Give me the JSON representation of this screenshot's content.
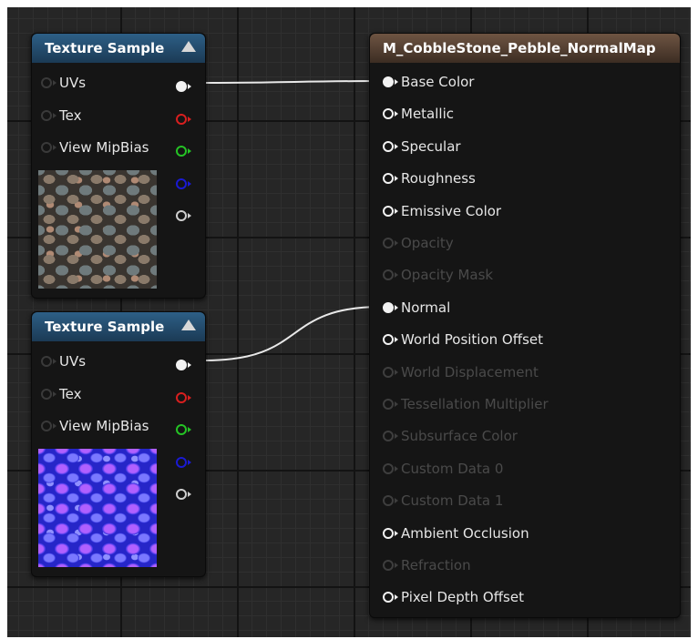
{
  "texture_nodes": [
    {
      "title": "Texture Sample",
      "inputs": [
        "UVs",
        "Tex",
        "View MipBias"
      ],
      "preview": "cobblestone-color-preview"
    },
    {
      "title": "Texture Sample",
      "inputs": [
        "UVs",
        "Tex",
        "View MipBias"
      ],
      "preview": "cobblestone-normal-preview"
    }
  ],
  "output_pin_colors": [
    "#f2f2f2",
    "#d81f1f",
    "#25c325",
    "#1a1ad2",
    "#cfcfcf"
  ],
  "material_node": {
    "title": "M_CobbleStone_Pebble_NormalMap",
    "pins": [
      {
        "label": "Base Color",
        "state": "connected"
      },
      {
        "label": "Metallic",
        "state": "active"
      },
      {
        "label": "Specular",
        "state": "active"
      },
      {
        "label": "Roughness",
        "state": "active"
      },
      {
        "label": "Emissive Color",
        "state": "active"
      },
      {
        "label": "Opacity",
        "state": "disabled"
      },
      {
        "label": "Opacity Mask",
        "state": "disabled"
      },
      {
        "label": "Normal",
        "state": "connected"
      },
      {
        "label": "World Position Offset",
        "state": "active"
      },
      {
        "label": "World Displacement",
        "state": "disabled"
      },
      {
        "label": "Tessellation Multiplier",
        "state": "disabled"
      },
      {
        "label": "Subsurface Color",
        "state": "disabled"
      },
      {
        "label": "Custom Data 0",
        "state": "disabled"
      },
      {
        "label": "Custom Data 1",
        "state": "disabled"
      },
      {
        "label": "Ambient Occlusion",
        "state": "active"
      },
      {
        "label": "Refraction",
        "state": "disabled"
      },
      {
        "label": "Pixel Depth Offset",
        "state": "active"
      }
    ]
  },
  "connections": [
    {
      "from": "texture_nodes.0.rgb",
      "to": "Base Color"
    },
    {
      "from": "texture_nodes.1.rgb",
      "to": "Normal"
    }
  ]
}
